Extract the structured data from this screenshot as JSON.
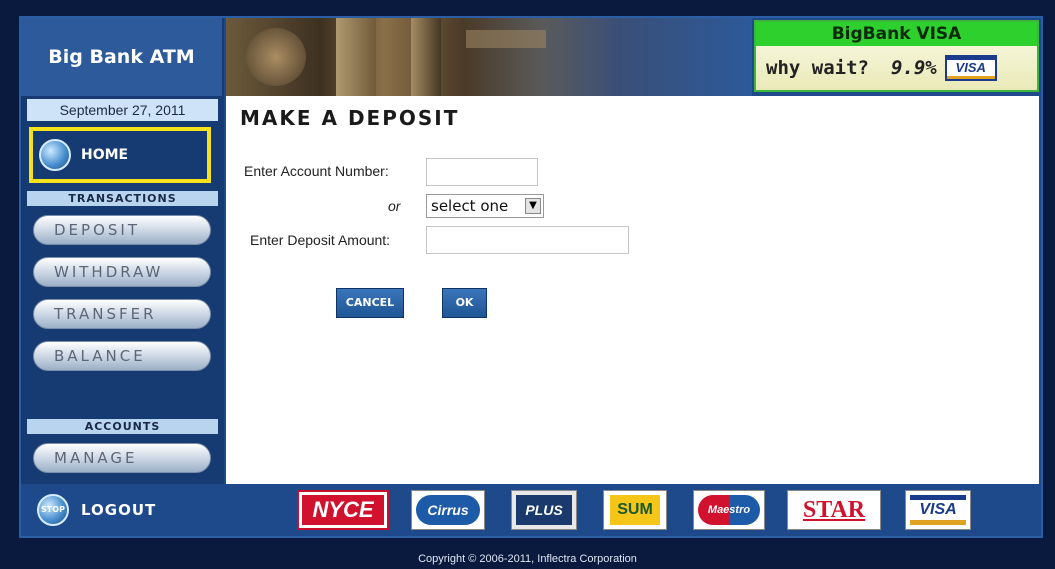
{
  "header": {
    "app_title": "Big Bank ATM",
    "ad": {
      "title": "BigBank VISA",
      "tagline": "why wait?",
      "rate": "9.9%",
      "card_label": "VISA"
    }
  },
  "sidebar": {
    "date": "September 27, 2011",
    "home_label": "HOME",
    "transactions_heading": "TRANSACTIONS",
    "transactions": [
      {
        "label": "DEPOSIT"
      },
      {
        "label": "WITHDRAW"
      },
      {
        "label": "TRANSFER"
      },
      {
        "label": "BALANCE"
      }
    ],
    "accounts_heading": "ACCOUNTS",
    "accounts": [
      {
        "label": "MANAGE"
      }
    ]
  },
  "main": {
    "title": "MAKE A DEPOSIT",
    "account_label": "Enter Account Number:",
    "account_value": "",
    "or_label": "or",
    "select_value": "select one",
    "amount_label": "Enter Deposit Amount:",
    "amount_value": "",
    "cancel_label": "CANCEL",
    "ok_label": "OK"
  },
  "footer": {
    "logout_label": "LOGOUT",
    "stop_text": "STOP",
    "logos": [
      "NYCE",
      "Cirrus",
      "PLUS",
      "SUM",
      "Maestro",
      "STAR",
      "VISA"
    ],
    "copyright": "Copyright © 2006-2011, Inflectra Corporation"
  },
  "colors": {
    "frame": "#0a1a3f",
    "app_blue": "#1e4a8c",
    "sidebar_blue": "#163a72",
    "home_highlight": "#f5e21a",
    "ad_green": "#2ed02e",
    "button_blue": "#2b64a8"
  }
}
